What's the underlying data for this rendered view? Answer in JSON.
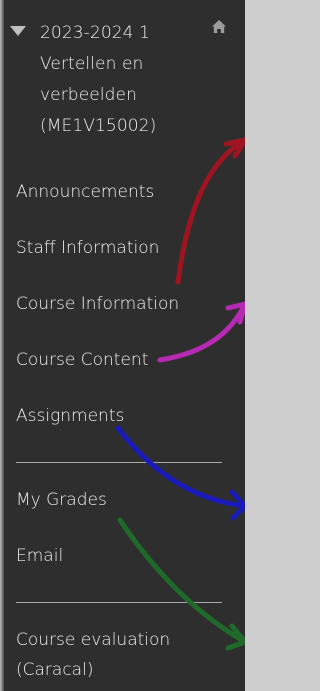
{
  "course": {
    "title_lines": [
      "2023-2024 1",
      "Vertellen en",
      "verbeelden",
      "(ME1V15002)"
    ]
  },
  "icons": {
    "collapse": "caret-down-icon",
    "home": "home-icon"
  },
  "menu": {
    "items": [
      {
        "label": "Announcements"
      },
      {
        "label": "Staff Information"
      },
      {
        "label": "Course Information"
      },
      {
        "label": "Course Content"
      },
      {
        "label": "Assignments"
      },
      {
        "label": "My Grades"
      },
      {
        "label": "Email"
      },
      {
        "label": "Course evaluation",
        "label_line2": "(Caracal)"
      }
    ]
  },
  "annotation_colors": {
    "red": "#9e1420",
    "magenta": "#b52ab2",
    "blue": "#1a1ab8",
    "green": "#1f6a2b"
  },
  "colors": {
    "panel_bg": "#2e2e2e",
    "text": "#efefef",
    "divider": "#a9a9a9"
  }
}
